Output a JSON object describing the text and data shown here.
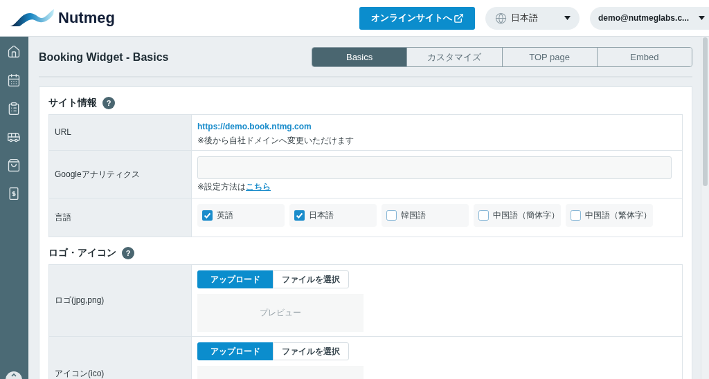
{
  "header": {
    "logo_text": "Nutmeg",
    "online_site_button": "オンラインサイトへ",
    "language_select": "日本語",
    "user_menu": "demo@nutmeglabs.c..."
  },
  "page": {
    "title": "Booking Widget - Basics",
    "tabs": [
      {
        "label": "Basics",
        "selected": true
      },
      {
        "label": "カスタマイズ",
        "selected": false
      },
      {
        "label": "TOP page",
        "selected": false
      },
      {
        "label": "Embed",
        "selected": false
      }
    ]
  },
  "sections": [
    {
      "title": "サイト情報",
      "help": "?",
      "rows": [
        {
          "kind": "link",
          "label": "URL",
          "link": "https://demo.book.ntmg.com",
          "note": "※後から自社ドメインへ変更いただけます"
        },
        {
          "kind": "input",
          "label": "Googleアナリティクス",
          "note": "※設定方法は",
          "note_link": "こちら"
        },
        {
          "kind": "checkboxes",
          "label": "言語",
          "options": [
            {
              "label": "英語",
              "checked": true
            },
            {
              "label": "日本語",
              "checked": true
            },
            {
              "label": "韓国語",
              "checked": false
            },
            {
              "label": "中国語（簡体字）",
              "checked": false
            },
            {
              "label": "中国語（繁体字）",
              "checked": false
            }
          ]
        }
      ]
    },
    {
      "title": "ロゴ・アイコン",
      "help": "?",
      "rows": [
        {
          "kind": "upload",
          "label": "ロゴ(jpg,png)",
          "upload_button": "アップロード",
          "choose_button": "ファイルを選択",
          "preview": "プレビュー"
        },
        {
          "kind": "upload",
          "label": "アイコン(ico)",
          "upload_button": "アップロード",
          "choose_button": "ファイルを選択"
        }
      ]
    }
  ]
}
